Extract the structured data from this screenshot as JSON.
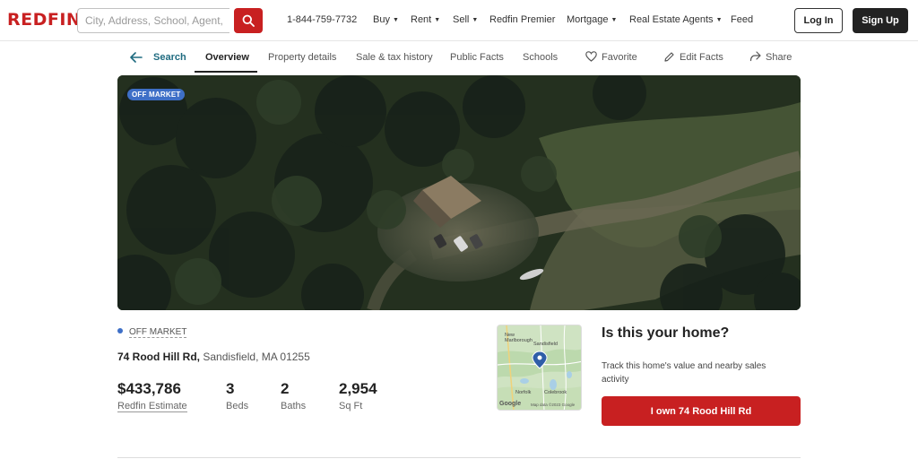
{
  "header": {
    "logo": "REDFIN",
    "search_placeholder": "City, Address, School, Agent, ZIP",
    "phone": "1-844-759-7732",
    "nav": [
      {
        "label": "Buy",
        "dropdown": true
      },
      {
        "label": "Rent",
        "dropdown": true
      },
      {
        "label": "Sell",
        "dropdown": true
      },
      {
        "label": "Redfin Premier",
        "dropdown": false
      },
      {
        "label": "Mortgage",
        "dropdown": true
      },
      {
        "label": "Real Estate Agents",
        "dropdown": true
      },
      {
        "label": "Feed",
        "dropdown": false
      }
    ],
    "login_label": "Log In",
    "signup_label": "Sign Up"
  },
  "subnav": {
    "search": "Search",
    "tabs": [
      "Overview",
      "Property details",
      "Sale & tax history",
      "Public Facts",
      "Schools"
    ],
    "favorite": "Favorite",
    "edit_facts": "Edit Facts",
    "share": "Share"
  },
  "hero": {
    "badge": "OFF MARKET"
  },
  "listing": {
    "status": "OFF MARKET",
    "street": "74 Rood Hill Rd,",
    "city_state_zip": "Sandisfield, MA 01255",
    "price": "$433,786",
    "price_label": "Redfin Estimate",
    "beds": "3",
    "beds_label": "Beds",
    "baths": "2",
    "baths_label": "Baths",
    "sqft": "2,954",
    "sqft_label": "Sq Ft"
  },
  "map": {
    "labels": [
      "New Marlborough",
      "Sandisfield",
      "Norfolk",
      "Colebrook"
    ],
    "attribution_logo": "Google",
    "attribution": "Map data ©2023 Google"
  },
  "claim": {
    "title": "Is this your home?",
    "description": "Track this home's value and nearby sales activity",
    "button": "I own 74 Rood Hill Rd"
  },
  "colors": {
    "brand_red": "#c82021",
    "badge_blue": "#3e6fc7",
    "link_teal": "#1f6b80"
  }
}
